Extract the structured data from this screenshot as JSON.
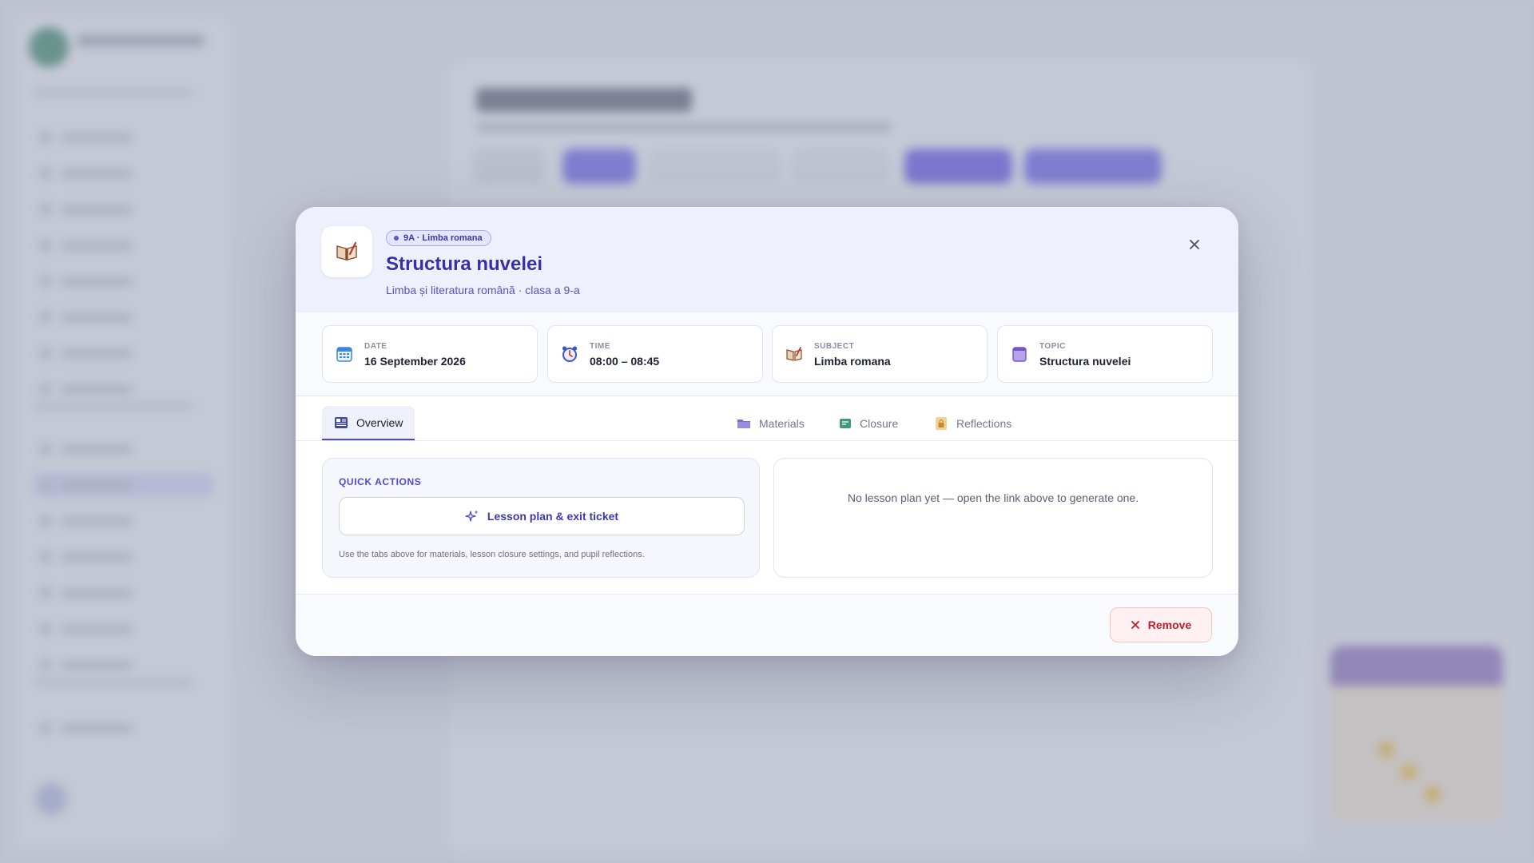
{
  "modal": {
    "badge": "9A · Limba romana",
    "title": "Structura nuvelei",
    "subtitle": "Limba și literatura română · clasa a 9-a",
    "lesson_icon": "open-book-icon",
    "close_icon": "close-icon"
  },
  "info_cards": [
    {
      "label": "DATE",
      "value": "16 September 2026",
      "icon": "calendar-icon"
    },
    {
      "label": "TIME",
      "value": "08:00 – 08:45",
      "icon": "alarm-clock-icon"
    },
    {
      "label": "SUBJECT",
      "value": "Limba romana",
      "icon": "open-book-icon"
    },
    {
      "label": "TOPIC",
      "value": "Structura nuvelei",
      "icon": "notebook-icon"
    }
  ],
  "tabs": [
    {
      "label": "Overview",
      "icon": "newspaper-icon",
      "active": true
    },
    {
      "label": "Materials",
      "icon": "folder-icon",
      "active": false
    },
    {
      "label": "Closure",
      "icon": "exit-ticket-icon",
      "active": false
    },
    {
      "label": "Reflections",
      "icon": "lock-icon",
      "active": false
    }
  ],
  "quick_actions": {
    "heading": "QUICK ACTIONS",
    "button_label": "Lesson plan & exit ticket",
    "button_icon": "sparkles-icon",
    "note": "Use the tabs above for materials, lesson closure settings, and pupil reflections."
  },
  "lesson_plan": {
    "empty_text": "No lesson plan yet — open the link above to generate one."
  },
  "footer": {
    "remove_label": "Remove",
    "remove_icon": "close-icon"
  },
  "colors": {
    "accent": "#4f49d2",
    "title": "#3830a8",
    "danger": "#c21c2c"
  }
}
